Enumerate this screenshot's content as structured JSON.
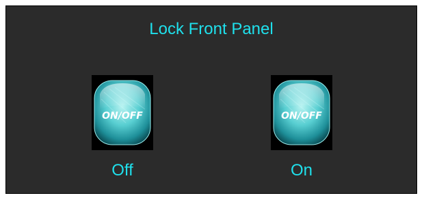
{
  "panel": {
    "title": "Lock Front Panel"
  },
  "buttons": [
    {
      "caption": "ON/OFF",
      "label": "Off",
      "icon": "power-toggle-icon"
    },
    {
      "caption": "ON/OFF",
      "label": "On",
      "icon": "power-toggle-icon"
    }
  ],
  "colors": {
    "background": "#2b2b2b",
    "accent": "#1fe0ec",
    "button_glow": "#5fd3d6"
  }
}
